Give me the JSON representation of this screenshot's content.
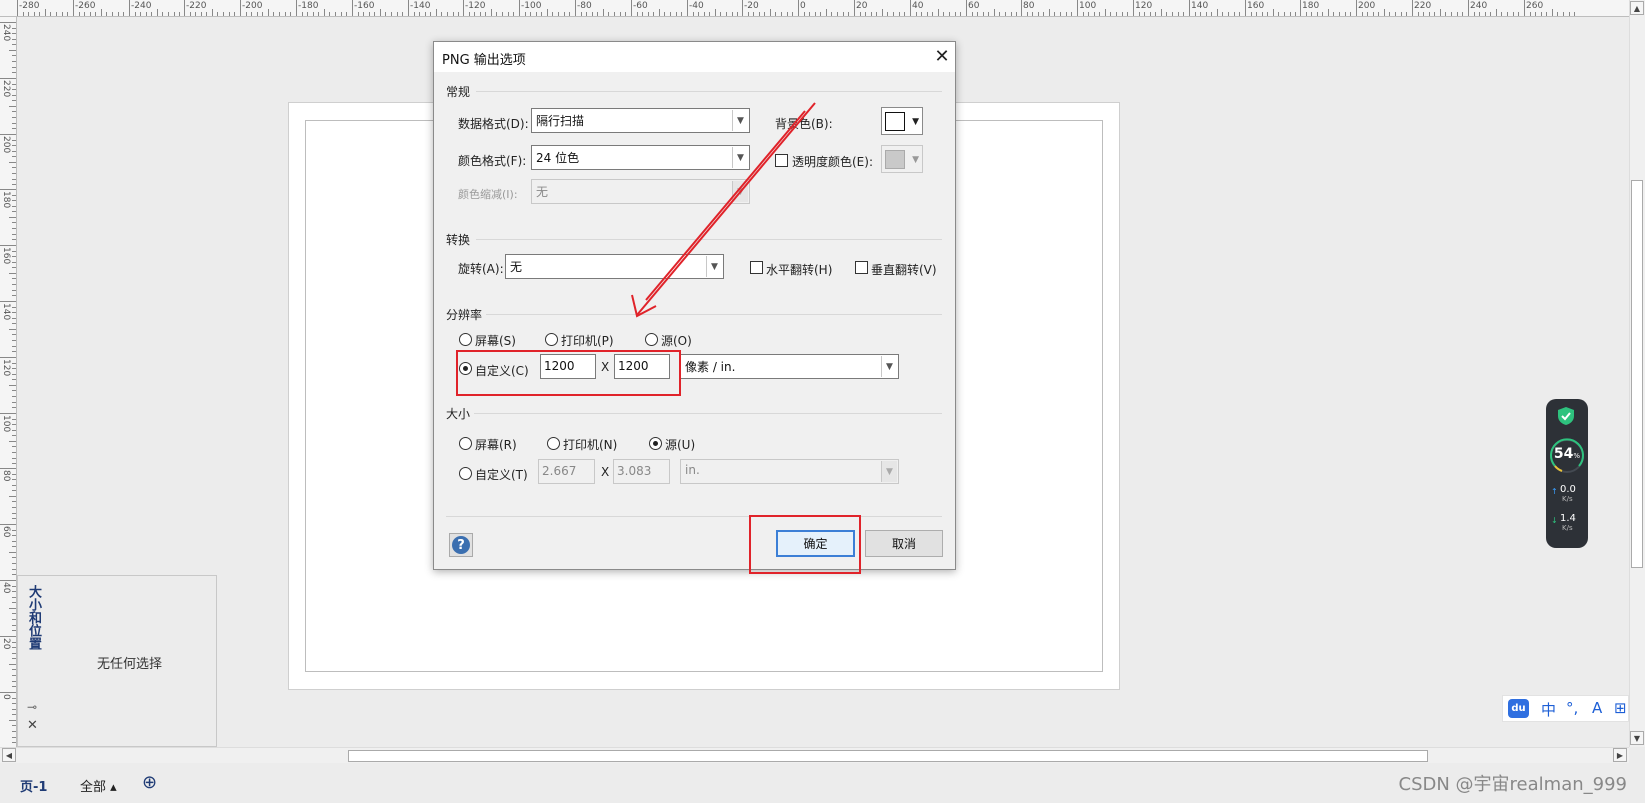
{
  "ruler": {
    "top_labels": [
      "-280",
      "-260",
      "-240",
      "-220",
      "-200",
      "-180",
      "-160",
      "-140",
      "-120",
      "-100",
      "-80",
      "-60",
      "-40",
      "-20",
      "0",
      "20",
      "40",
      "60",
      "80",
      "100",
      "120",
      "140",
      "160",
      "180",
      "200",
      "220",
      "240",
      "260"
    ],
    "left_labels": [
      "240",
      "220",
      "200",
      "180",
      "160",
      "140",
      "120",
      "100",
      "80",
      "60",
      "40",
      "20",
      "0"
    ]
  },
  "dialog": {
    "title": "PNG 输出选项",
    "close_glyph": "✕",
    "general": {
      "section": "常规",
      "data_format_label": "数据格式(D):",
      "data_format_value": "隔行扫描",
      "color_format_label": "颜色格式(F):",
      "color_format_value": "24 位色",
      "color_reduction_label": "颜色缩减(I):",
      "color_reduction_value": "无",
      "background_label": "背景色(B):",
      "transparency_label": "透明度颜色(E):"
    },
    "transform": {
      "section": "转换",
      "rotate_label": "旋转(A):",
      "rotate_value": "无",
      "flip_h_label": "水平翻转(H)",
      "flip_v_label": "垂直翻转(V)"
    },
    "resolution": {
      "section": "分辨率",
      "screen_label": "屏幕(S)",
      "printer_label": "打印机(P)",
      "source_label": "源(O)",
      "custom_label": "自定义(C)",
      "width_value": "1200",
      "height_value": "1200",
      "times": "X",
      "unit_value": "像素 / in."
    },
    "size": {
      "section": "大小",
      "screen_label": "屏幕(R)",
      "printer_label": "打印机(N)",
      "source_label": "源(U)",
      "custom_label": "自定义(T)",
      "width_value": "2.667",
      "height_value": "3.083",
      "times": "X",
      "unit_value": "in."
    },
    "help_glyph": "?",
    "ok_label": "确定",
    "cancel_label": "取消"
  },
  "side_panel": {
    "title": "大小和位置",
    "empty_text": "无任何选择",
    "pin_glyph": "⊸",
    "close_glyph": "✕"
  },
  "statusbar": {
    "page_tab": "页-1",
    "all_label": "全部 ▴",
    "add_glyph": "⊕"
  },
  "watermark": "CSDN @宇宙realman_999",
  "speed_widget": {
    "percent": "54",
    "percent_unit": "%",
    "up_value": "0.0",
    "down_value": "1.4",
    "unit": "K/s",
    "up_arrow": "↑",
    "down_arrow": "↓"
  },
  "ime": {
    "logo": "du",
    "lang": "中",
    "punct": "°,",
    "mode": "A",
    "grid": "⊞"
  },
  "colors": {
    "highlight": "#e0232a",
    "accent": "#3c7fd6"
  }
}
